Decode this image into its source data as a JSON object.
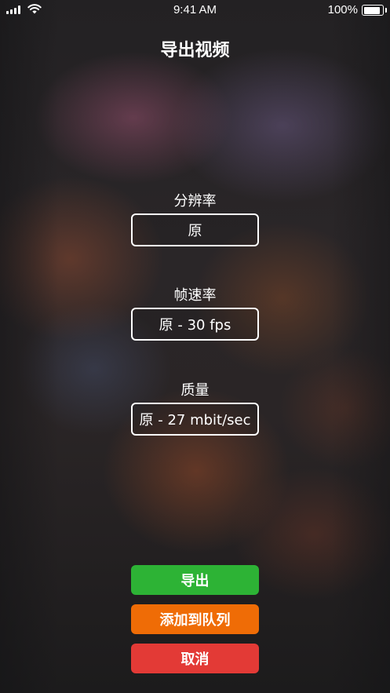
{
  "status_bar": {
    "time": "9:41 AM",
    "battery_percent": "100%",
    "battery_level": 1.0,
    "signal_bars": 4,
    "icons": [
      "signal-icon",
      "wifi-icon",
      "battery-icon"
    ]
  },
  "title": "导出视频",
  "settings": {
    "resolution": {
      "label": "分辨率",
      "value": "原"
    },
    "frame_rate": {
      "label": "帧速率",
      "value": "原 - 30 fps"
    },
    "quality": {
      "label": "质量",
      "value": "原 - 27 mbit/sec"
    }
  },
  "buttons": {
    "export": {
      "label": "导出",
      "color": "#2db335"
    },
    "add_to_queue": {
      "label": "添加到队列",
      "color": "#ef6c06"
    },
    "cancel": {
      "label": "取消",
      "color": "#e33a36"
    }
  },
  "colors": {
    "text": "#ffffff",
    "field_border": "#ffffff"
  }
}
